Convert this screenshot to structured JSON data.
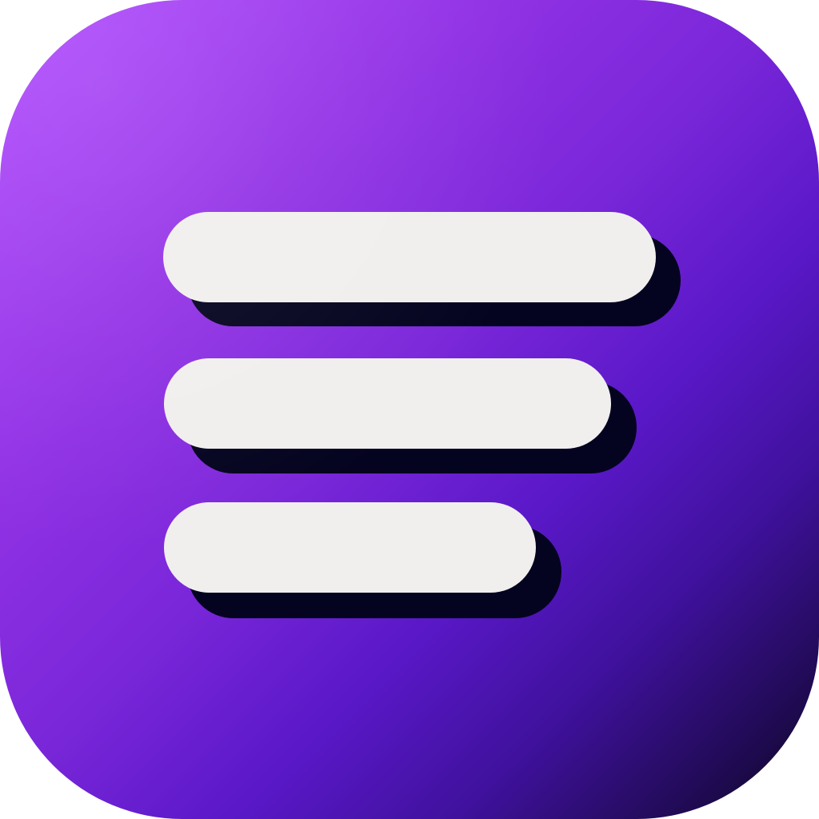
{
  "icon": {
    "name": "menu-lines-icon",
    "colors": {
      "gradient_start": "#b24cff",
      "gradient_mid": "#7a27d9",
      "gradient_deep": "#3f119c",
      "gradient_end": "#05030e",
      "bar_fill": "#f1efee",
      "bar_shadow": "#050420"
    },
    "bar_count": 3
  }
}
